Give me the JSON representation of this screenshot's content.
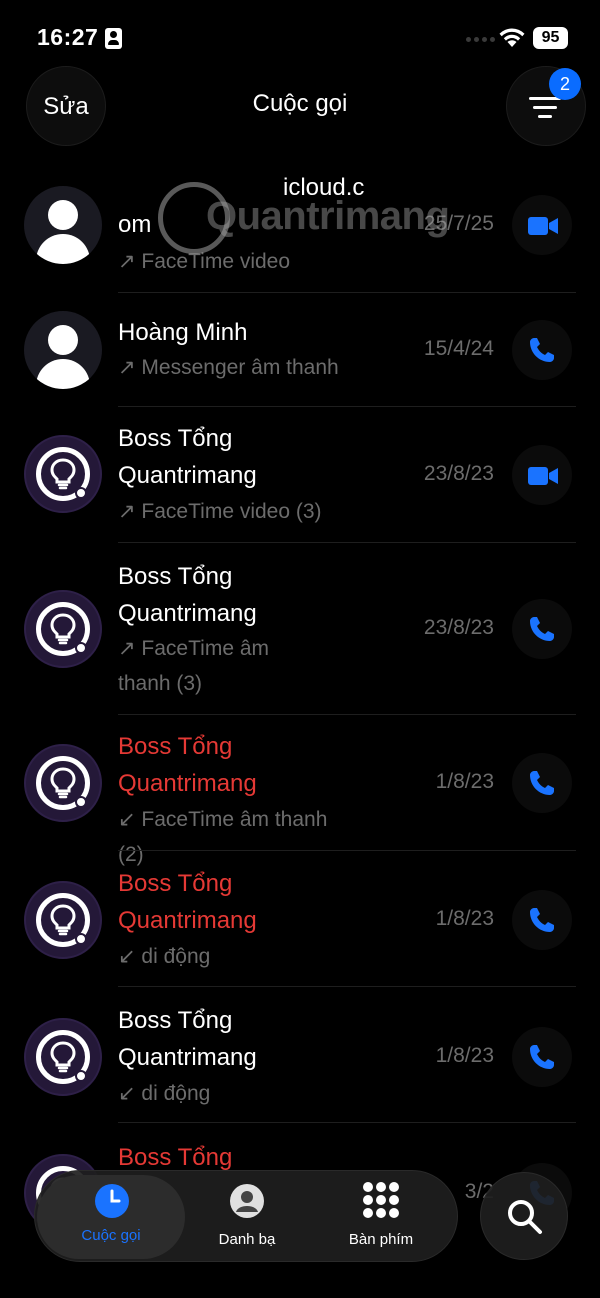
{
  "status_bar": {
    "time": "16:27",
    "battery": "95"
  },
  "header": {
    "edit_label": "Sửa",
    "title": "Cuộc gọi",
    "filter_badge": "2"
  },
  "overlay": {
    "watermark_text": "Quantrimang",
    "icloud_text": "icloud.c"
  },
  "calls": [
    {
      "name": "om",
      "name_lines": [
        "om"
      ],
      "detail": "↗ FaceTime video",
      "detail_lines": [
        "↗ FaceTime video"
      ],
      "date": "25/7/25",
      "missed": false,
      "type": "video",
      "avatar": "generic"
    },
    {
      "name": "Hoàng Minh",
      "name_lines": [
        "Hoàng Minh"
      ],
      "detail": "↗ Messenger âm thanh",
      "detail_lines": [
        "↗ Messenger âm thanh"
      ],
      "date": "15/4/24",
      "missed": false,
      "type": "audio",
      "avatar": "generic"
    },
    {
      "name_lines": [
        "Boss Tổng",
        "Quantrimang"
      ],
      "detail_lines": [
        "↗ FaceTime video (3)"
      ],
      "date": "23/8/23",
      "missed": false,
      "type": "video",
      "avatar": "logo"
    },
    {
      "name_lines": [
        "Boss Tổng",
        "Quantrimang"
      ],
      "detail_lines": [
        "↗ FaceTime âm",
        "thanh (3)"
      ],
      "date": "23/8/23",
      "missed": false,
      "type": "audio",
      "avatar": "logo"
    },
    {
      "name_lines": [
        "Boss Tổng",
        "Quantrimang"
      ],
      "detail_lines": [
        "↙ FaceTime âm thanh (2)"
      ],
      "date": "1/8/23",
      "missed": true,
      "type": "audio",
      "avatar": "logo"
    },
    {
      "name_lines": [
        "Boss Tổng",
        "Quantrimang"
      ],
      "detail_lines": [
        "↙ di động"
      ],
      "date": "1/8/23",
      "missed": true,
      "type": "audio",
      "avatar": "logo"
    },
    {
      "name_lines": [
        "Boss Tổng",
        "Quantrimang"
      ],
      "detail_lines": [
        "↙ di động"
      ],
      "date": "1/8/23",
      "missed": false,
      "type": "audio",
      "avatar": "logo"
    },
    {
      "name_lines": [
        "Boss Tổng"
      ],
      "detail_lines": [],
      "date": "3/2",
      "missed": true,
      "type": "audio",
      "avatar": "logo"
    }
  ],
  "tabs": [
    {
      "label": "Cuộc gọi",
      "icon": "clock-icon",
      "active": true
    },
    {
      "label": "Danh bạ",
      "icon": "person-circle-icon",
      "active": false
    },
    {
      "label": "Bàn phím",
      "icon": "keypad-icon",
      "active": false
    }
  ],
  "colors": {
    "accent": "#1a73ff",
    "missed": "#e53935",
    "secondary_text": "#6c6c6c",
    "background": "#000000"
  }
}
